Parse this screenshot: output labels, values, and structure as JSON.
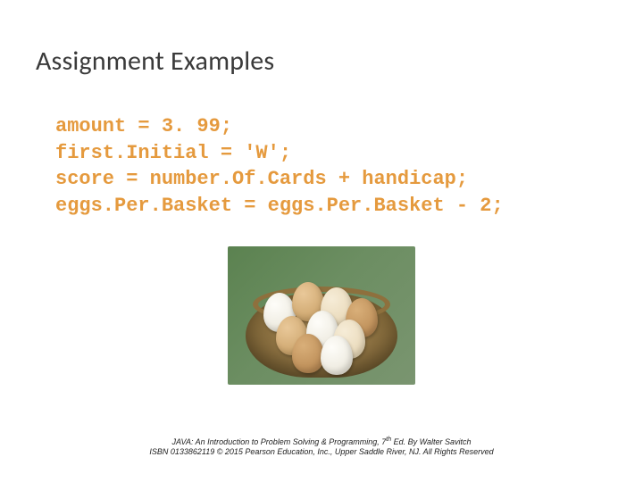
{
  "title": "Assignment Examples",
  "code": {
    "line1": "amount = 3. 99;",
    "line2": "first.Initial = 'W';",
    "line3": "score = number.Of.Cards + handicap;",
    "line4": "eggs.Per.Basket = eggs.Per.Basket - 2;"
  },
  "footer": {
    "line1a": "JAVA: An Introduction to Problem Solving & Programming, 7",
    "line1sup": "th",
    "line1b": " Ed. By Walter Savitch",
    "line2": "ISBN 0133862119 © 2015 Pearson Education, Inc., Upper Saddle River, NJ. All Rights Reserved"
  }
}
